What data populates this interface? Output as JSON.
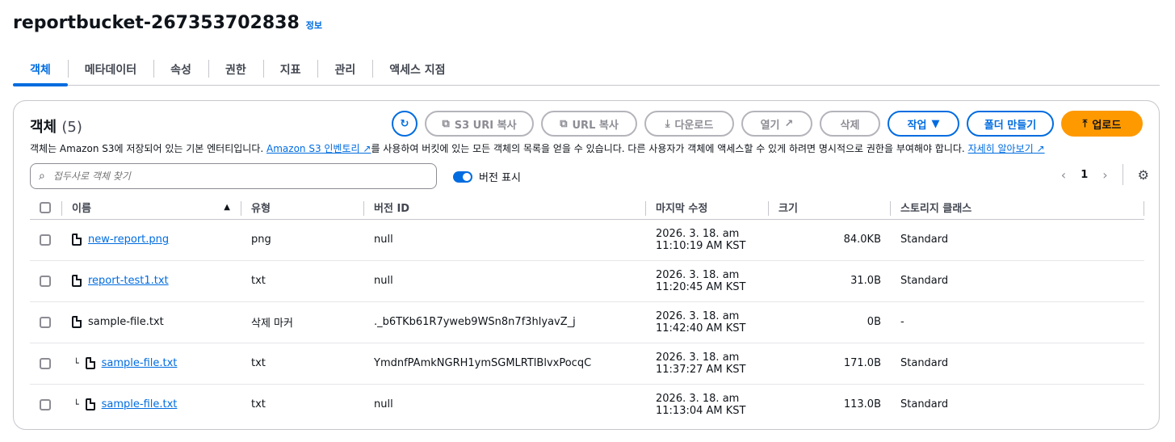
{
  "page": {
    "title": "reportbucket-267353702838",
    "info": "정보"
  },
  "tabs": [
    {
      "label": "객체",
      "active": true
    },
    {
      "label": "메타데이터"
    },
    {
      "label": "속성"
    },
    {
      "label": "권한"
    },
    {
      "label": "지표"
    },
    {
      "label": "관리"
    },
    {
      "label": "액세스 지점"
    }
  ],
  "panel": {
    "title": "객체",
    "count": "(5)",
    "description_pre": "객체는 Amazon S3에 저장되어 있는 기본 엔터티입니다.",
    "description_link": "Amazon S3 인벤토리",
    "description_mid": "를 사용하여 버킷에 있는 모든 객체의 목록을 얻을 수 있습니다. 다른 사용자가 객체에 액세스할 수 있게 하려면 명시적으로 권한을 부여해야 합니다.",
    "description_link2": "자세히 알아보기"
  },
  "toolbar": {
    "copy_s3_uri": "S3 URI 복사",
    "copy_url": "URL 복사",
    "download": "다운로드",
    "open": "열기",
    "delete": "삭제",
    "actions": "작업",
    "create_folder": "폴더 만들기",
    "upload": "업로드"
  },
  "search": {
    "placeholder": "접두사로 객체 찾기"
  },
  "versions_toggle": {
    "label": "버전 표시",
    "on": true
  },
  "pagination": {
    "page": "1"
  },
  "table": {
    "headers": {
      "name": "이름",
      "type": "유형",
      "version_id": "버전 ID",
      "last_modified": "마지막 수정",
      "size": "크기",
      "storage_class": "스토리지 클래스"
    },
    "rows": [
      {
        "name": "new-report.png",
        "link": true,
        "child": false,
        "type": "png",
        "version_id": "null",
        "date": "2026. 3. 18. am",
        "time": "11:10:19 AM KST",
        "size": "84.0KB",
        "storage_class": "Standard"
      },
      {
        "name": "report-test1.txt",
        "link": true,
        "child": false,
        "type": "txt",
        "version_id": "null",
        "date": "2026. 3. 18. am",
        "time": "11:20:45 AM KST",
        "size": "31.0B",
        "storage_class": "Standard"
      },
      {
        "name": "sample-file.txt",
        "link": false,
        "child": false,
        "type": "삭제 마커",
        "version_id": "._b6TKb61R7yweb9WSn8n7f3hlyavZ_j",
        "date": "2026. 3. 18. am",
        "time": "11:42:40 AM KST",
        "size": "0B",
        "storage_class": "-"
      },
      {
        "name": "sample-file.txt",
        "link": true,
        "child": true,
        "type": "txt",
        "version_id": "YmdnfPAmkNGRH1ymSGMLRTlBlvxPocqC",
        "date": "2026. 3. 18. am",
        "time": "11:37:27 AM KST",
        "size": "171.0B",
        "storage_class": "Standard"
      },
      {
        "name": "sample-file.txt",
        "link": true,
        "child": true,
        "type": "txt",
        "version_id": "null",
        "date": "2026. 3. 18. am",
        "time": "11:13:04 AM KST",
        "size": "113.0B",
        "storage_class": "Standard"
      }
    ]
  }
}
